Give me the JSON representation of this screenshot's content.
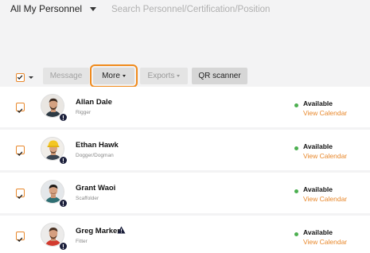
{
  "filter": {
    "label": "All My Personnel"
  },
  "search": {
    "placeholder": "Search Personnel/Certification/Position",
    "value": ""
  },
  "toolbar": {
    "message_label": "Message",
    "more_label": "More",
    "exports_label": "Exports",
    "qr_label": "QR scanner"
  },
  "colors": {
    "accent": "#e8882c",
    "highlight": "#f08a1c",
    "available": "#4caf50",
    "badge": "#1b1f3b"
  },
  "personnel": [
    {
      "name": "Allan Dale",
      "role": "Rigger",
      "status": "Available",
      "calendar": "View Calendar",
      "checked": true,
      "warning": false
    },
    {
      "name": "Ethan Hawk",
      "role": "Dogger/Dogman",
      "status": "Available",
      "calendar": "View Calendar",
      "checked": true,
      "warning": false
    },
    {
      "name": "Grant Waoi",
      "role": "Scaffolder",
      "status": "Available",
      "calendar": "View Calendar",
      "checked": true,
      "warning": false
    },
    {
      "name": "Greg Marker",
      "role": "Fitter",
      "status": "Available",
      "calendar": "View Calendar",
      "checked": true,
      "warning": true
    }
  ]
}
